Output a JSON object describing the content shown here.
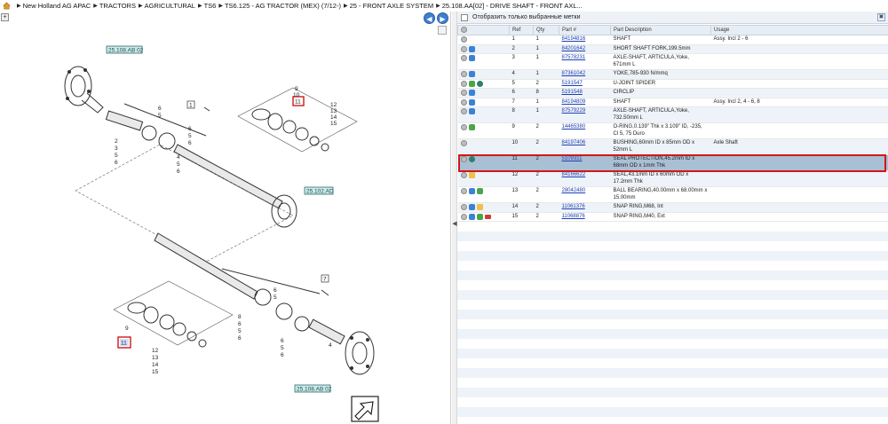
{
  "breadcrumb": [
    "New Holland AG APAC",
    "TRACTORS",
    "AGRICULTURAL",
    "TS6",
    "TS6.125 - AG TRACTOR (MEX) (7/12-)",
    "25 - FRONT AXLE SYSTEM",
    "25.108.AA[02] - DRIVE SHAFT - FRONT AXL..."
  ],
  "diagram": {
    "ref_labels": {
      "top_left": "25.108.AB 02",
      "middle": "25.102.AD",
      "bottom": "25.108.AB 02"
    },
    "callouts": {
      "group1": "1",
      "group7": "7",
      "highlight_top": "11",
      "highlight_bottom": "11"
    },
    "numbers": {
      "n2": "2",
      "n3": "3",
      "n4": "4",
      "n5": "5",
      "n6": "6",
      "n8": "8",
      "n9": "9",
      "n10": "10",
      "n12": "12",
      "n13": "13",
      "n14": "14",
      "n15": "15"
    }
  },
  "right": {
    "filter_label": "Отобразить только выбранные метки",
    "columns": {
      "ref": "Ref",
      "qty": "Qty",
      "part": "Part #",
      "desc": "Part Description",
      "usage": "Usage"
    },
    "rows": [
      {
        "ref": "1",
        "qty": "1",
        "part": "84194816",
        "desc": "SHAFT",
        "usage": "Assy. Incl 2 - 6"
      },
      {
        "ref": "2",
        "qty": "1",
        "part": "84201642",
        "desc": "SHORT SHAFT FORK,199.5mm",
        "usage": ""
      },
      {
        "ref": "3",
        "qty": "1",
        "part": "87578231",
        "desc": "AXLE-SHAFT, ARTICULA,Yoke, 671mm L",
        "usage": ""
      },
      {
        "ref": "4",
        "qty": "1",
        "part": "87361042",
        "desc": "YOKE,785-930 N/mmq",
        "usage": ""
      },
      {
        "ref": "5",
        "qty": "2",
        "part": "5191547",
        "desc": "U-JOINT SPIDER",
        "usage": ""
      },
      {
        "ref": "6",
        "qty": "8",
        "part": "5191548",
        "desc": "CIRCLIP",
        "usage": ""
      },
      {
        "ref": "7",
        "qty": "1",
        "part": "84194809",
        "desc": "SHAFT",
        "usage": "Assy. Incl 2, 4 - 6, 8"
      },
      {
        "ref": "8",
        "qty": "1",
        "part": "87579229",
        "desc": "AXLE-SHAFT, ARTICULA,Yoke, 732.50mm L",
        "usage": ""
      },
      {
        "ref": "9",
        "qty": "2",
        "part": "14465380",
        "desc": "O-RING,0.139\" Thk x 3.109\" ID, -235, Cl 5, 75 Duro",
        "usage": ""
      },
      {
        "ref": "10",
        "qty": "2",
        "part": "84197406",
        "desc": "BUSHING,60mm ID x 85mm OD x 52mm L",
        "usage": "Axle Shaft"
      },
      {
        "ref": "11",
        "qty": "2",
        "part": "5109311",
        "desc": "SEAL PROTECTION,45.2mm ID x 68mm OD x 1mm Thk",
        "usage": ""
      },
      {
        "ref": "12",
        "qty": "2",
        "part": "84166622",
        "desc": "SEAL,43.1mm ID x 60mm OD x 17.2mm Thk",
        "usage": ""
      },
      {
        "ref": "13",
        "qty": "2",
        "part": "28042480",
        "desc": "BALL BEARING,40.00mm x 68.00mm x 15.00mm",
        "usage": ""
      },
      {
        "ref": "14",
        "qty": "2",
        "part": "11061376",
        "desc": "SNAP RING,M68, Int",
        "usage": ""
      },
      {
        "ref": "15",
        "qty": "2",
        "part": "11068876",
        "desc": "SNAP RING,M40, Ext",
        "usage": ""
      }
    ]
  }
}
